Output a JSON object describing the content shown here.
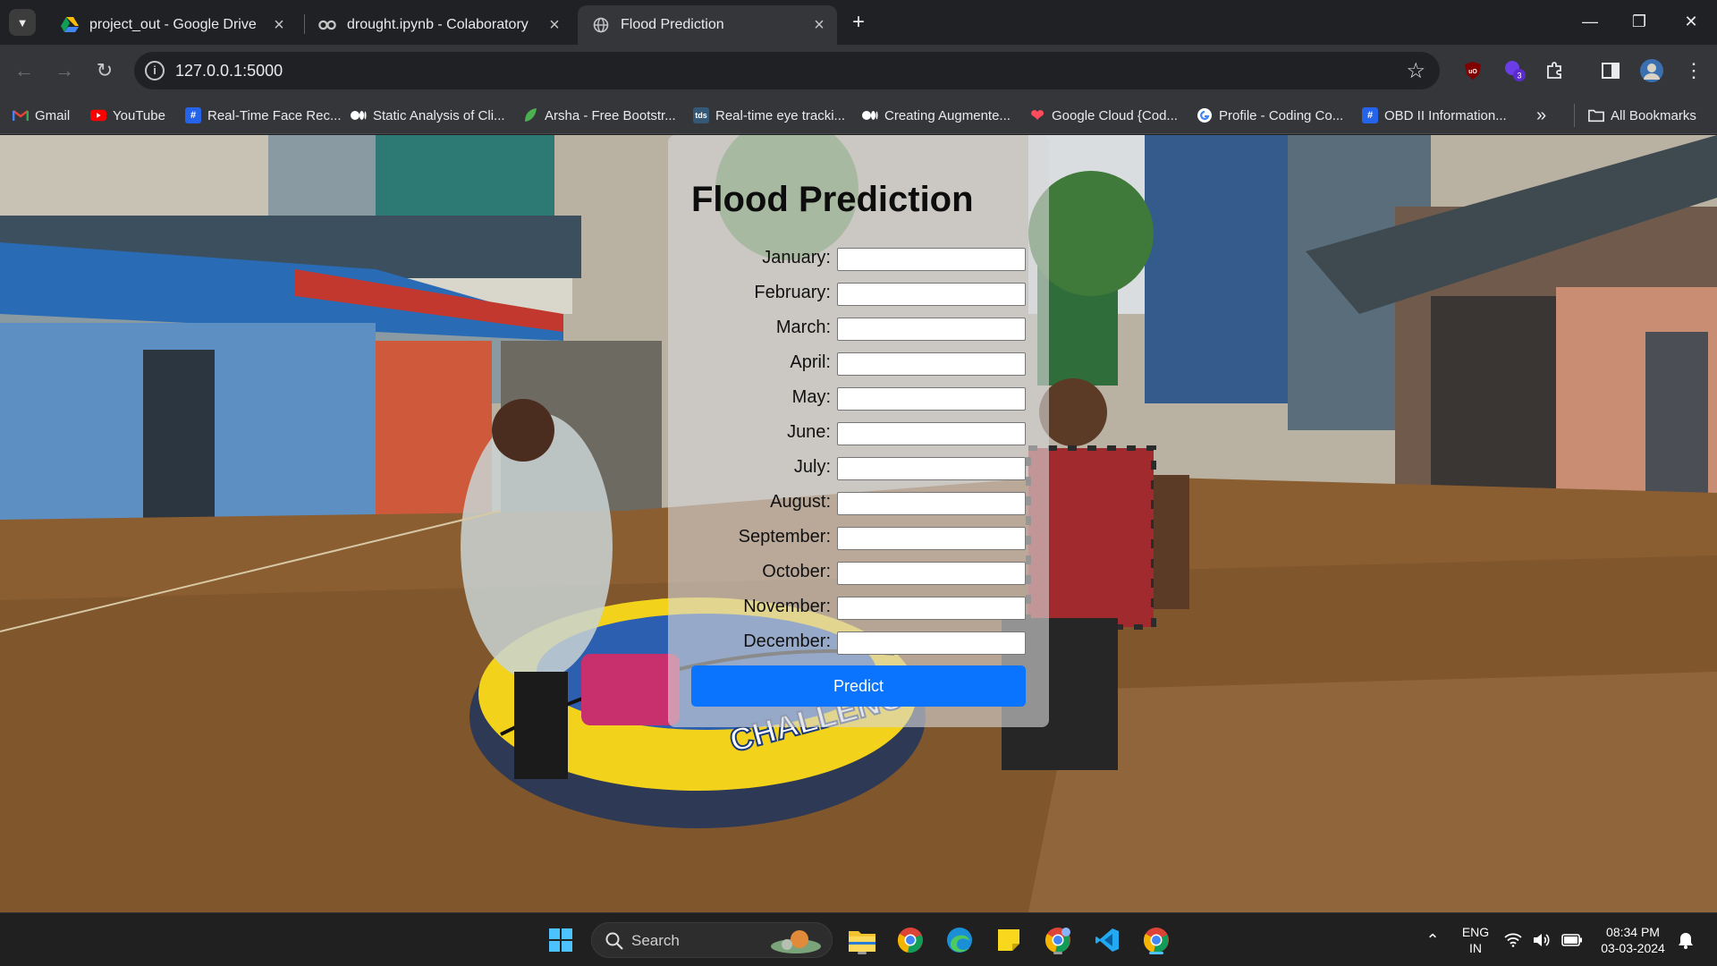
{
  "browser": {
    "tabs": [
      {
        "title": "project_out - Google Drive",
        "icon": "google-drive-icon"
      },
      {
        "title": "drought.ipynb - Colaboratory",
        "icon": "colab-icon"
      },
      {
        "title": "Flood Prediction",
        "icon": "globe-icon",
        "active": true
      }
    ],
    "url": "127.0.0.1:5000",
    "extension_badge": "3",
    "bookmarks": [
      {
        "label": "Gmail",
        "icon": "gmail-icon"
      },
      {
        "label": "YouTube",
        "icon": "youtube-icon"
      },
      {
        "label": "Real-Time Face Rec...",
        "icon": "hashnode-icon"
      },
      {
        "label": "Static Analysis of Cli...",
        "icon": "medium-icon"
      },
      {
        "label": "Arsha - Free Bootstr...",
        "icon": "leaf-icon"
      },
      {
        "label": "Real-time eye tracki...",
        "icon": "tds-icon"
      },
      {
        "label": "Creating Augmente...",
        "icon": "medium-icon"
      },
      {
        "label": "Google Cloud {Cod...",
        "icon": "heart-icon"
      },
      {
        "label": "Profile - Coding Co...",
        "icon": "google-icon"
      },
      {
        "label": "OBD II Information...",
        "icon": "hashnode-icon"
      }
    ],
    "all_bookmarks_label": "All Bookmarks"
  },
  "form": {
    "title": "Flood Prediction",
    "months": [
      "January:",
      "February:",
      "March:",
      "April:",
      "May:",
      "June:",
      "July:",
      "August:",
      "September:",
      "October:",
      "November:",
      "December:"
    ],
    "predict_label": "Predict",
    "button_color": "#0a74ff"
  },
  "taskbar": {
    "search_label": "Search",
    "language": "ENG",
    "region": "IN",
    "time": "08:34 PM",
    "date": "03-03-2024"
  }
}
